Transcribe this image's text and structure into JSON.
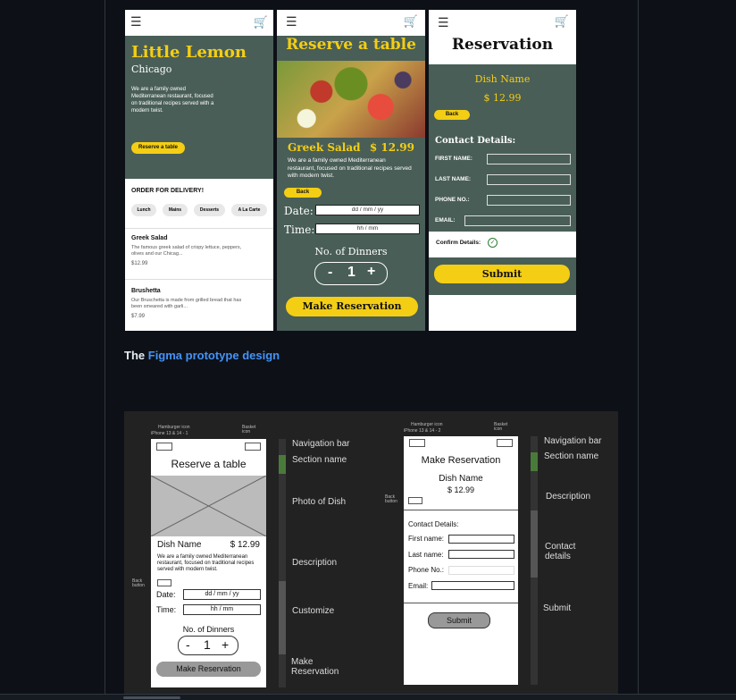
{
  "phone1": {
    "title": "Little Lemon",
    "city": "Chicago",
    "desc": "We are a family owned Mediterranean restaurant, focused on traditional recipes served with a modern twist.",
    "reserve_btn": "Reserve a table",
    "delivery_heading": "ORDER FOR DELIVERY!",
    "categories": [
      "Lunch",
      "Mains",
      "Desserts",
      "A La Carte"
    ],
    "items": [
      {
        "name": "Greek Salad",
        "desc": "The famous greek salad of crispy lettuce, peppers, olives and our Chicag...",
        "price": "$12.99"
      },
      {
        "name": "Brushetta",
        "desc": "Our Bruschetta is made from grilled bread that has been smeared with garli...",
        "price": "$7.99"
      }
    ]
  },
  "phone2": {
    "title": "Reserve a table",
    "dish": "Greek Salad",
    "price": "$ 12.99",
    "desc": "We are a family owned Mediterranean restaurant, focused on traditional recipes served with modern twist.",
    "back": "Back",
    "date_label": "Date:",
    "date_ph": "dd / mm / yy",
    "time_label": "Time:",
    "time_ph": "hh / mm",
    "dinners_label": "No. of Dinners",
    "minus": "-",
    "count": "1",
    "plus": "+",
    "make_btn": "Make Reservation"
  },
  "phone3": {
    "title": "Reservation",
    "dish": "Dish Name",
    "price": "$ 12.99",
    "back": "Back",
    "contact": "Contact Details:",
    "first": "FIRST NAME:",
    "last": "LAST NAME:",
    "phone": "PHONE NO.:",
    "email": "EMAIL:",
    "confirm": "Confirm Details:",
    "submit": "Submit"
  },
  "caption": {
    "prefix": "The",
    "link": "Figma prototype design"
  },
  "wire1": {
    "hamburger": "Hamburger icon",
    "iphone": "iPhone 13 & 14 - 1",
    "basket": "Basket icon",
    "title": "Reserve a table",
    "dish": "Dish Name",
    "price": "$ 12.99",
    "desc": "We are a family owned Mediterranean restaurant, focused on traditional recipes served with modern twist.",
    "back_btn": "Back button",
    "date": "Date:",
    "date_ph": "dd / mm / yy",
    "time": "Time:",
    "time_ph": "hh / mm",
    "dinners": "No. of Dinners",
    "minus": "-",
    "count": "1",
    "plus": "+",
    "make": "Make Reservation",
    "labels": [
      "Navigation bar",
      "Section name",
      "Photo of Dish",
      "Description",
      "Customize",
      "Make Reservation"
    ]
  },
  "wire2": {
    "hamburger": "Hamburger icon",
    "iphone": "iPhone 13 & 14 - 2",
    "basket": "Basket icon",
    "title": "Make Reservation",
    "dish": "Dish Name",
    "price": "$ 12.99",
    "back_btn": "Back button",
    "contact": "Contact Details:",
    "first": "First name:",
    "last": "Last name:",
    "phone": "Phone No.:",
    "email": "Email:",
    "submit": "Submit",
    "labels": [
      "Navigation bar",
      "Section name",
      "Description",
      "Contact details",
      "Submit"
    ]
  }
}
